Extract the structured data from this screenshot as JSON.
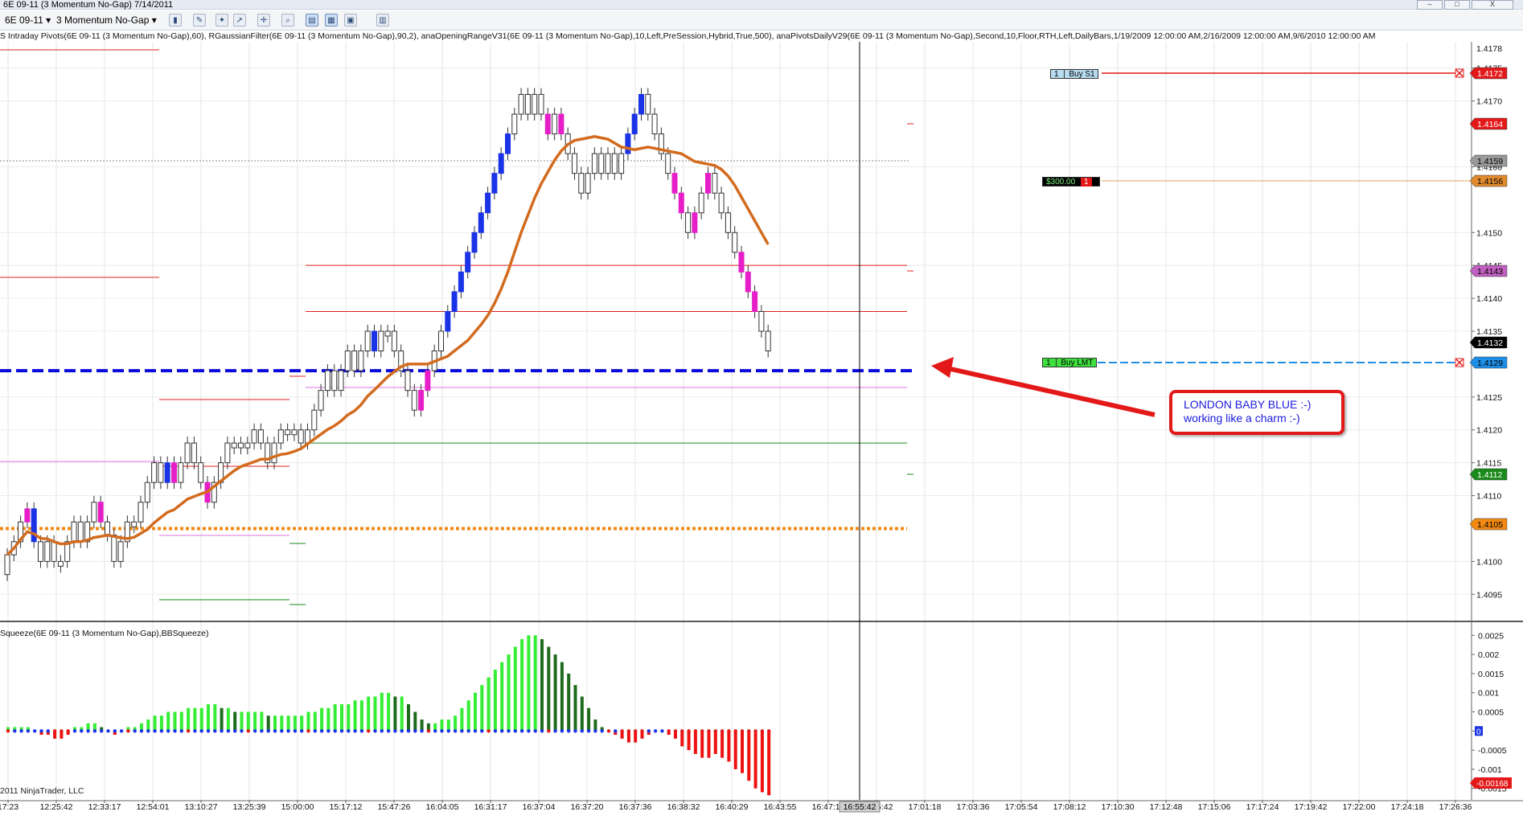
{
  "window": {
    "title": "6E 09-11 (3 Momentum No-Gap)  7/14/2011",
    "minimize": "–",
    "maximize": "□",
    "close": "X"
  },
  "toolbar": {
    "instrument": "6E 09-11",
    "period": "3 Momentum No-Gap"
  },
  "indicators_line": "S Intraday Pivots(6E 09-11 (3 Momentum No-Gap),60),  RGaussianFilter(6E 09-11 (3 Momentum No-Gap),90,2), anaOpeningRangeV31(6E 09-11 (3 Momentum No-Gap),10,Left,PreSession,Hybrid,True,500), anaPivotsDailyV29(6E 09-11 (3 Momentum No-Gap),Second,10,Floor,RTH,Left,DailyBars,1/19/2009 12:00:00 AM,2/16/2009 12:00:00 AM,9/6/2010 12:00:00 AM",
  "squeeze_label": "Squeeze(6E 09-11 (3 Momentum No-Gap),BBSqueeze)",
  "copyright": "2011 NinjaTrader, LLC",
  "callout": {
    "line1": "LONDON BABY BLUE :-)",
    "line2": "working like a charm :-)"
  },
  "orders": {
    "buy_s1": "Buy S1",
    "buy_s1_qty": "1",
    "buy_lmt": "Buy LMT",
    "buy_lmt_qty": "1",
    "position_pnl": "$300.00",
    "position_qty": "1"
  },
  "colors": {
    "up_candle": "#1a33e6",
    "down_candle": "#e61ec8",
    "gaussian": "#d36b1e",
    "london_line": "#0a0adc",
    "resistance": "#e02020",
    "support": "#1a8a1a",
    "opening_range": "#f28a12",
    "squeeze_up_strong": "#33ee33",
    "squeeze_up_weak": "#1e6b1e",
    "squeeze_down": "#ee1111"
  },
  "chart_data": {
    "type": "candlestick",
    "instrument": "6E 09-11",
    "price_axis_ticks": [
      1.4175,
      1.417,
      1.416,
      1.415,
      1.4145,
      1.414,
      1.4135,
      1.4125,
      1.412,
      1.4115,
      1.411,
      1.41,
      1.4095
    ],
    "price_axis_top_partial": [
      "1.4178",
      "1.4160"
    ],
    "price_markers": [
      {
        "label": "1.4172",
        "color": "#e31919",
        "text_color": "#ffffff"
      },
      {
        "label": "1.4164",
        "color": "#e31919",
        "text_color": "#ffffff"
      },
      {
        "label": "1.4159",
        "color": "#9a9a9a",
        "text_color": "#000000"
      },
      {
        "label": "1.4156",
        "color": "#e08a2e",
        "text_color": "#000000"
      },
      {
        "label": "1.4143",
        "color": "#c060c0",
        "text_color": "#000000"
      },
      {
        "label": "1.4132",
        "color": "#000000",
        "text_color": "#ffffff"
      },
      {
        "label": "1.4129",
        "color": "#1e8ee6",
        "text_color": "#000000"
      },
      {
        "label": "1.4112",
        "color": "#1a8a1a",
        "text_color": "#ffffff"
      },
      {
        "label": "1.4105",
        "color": "#f28a12",
        "text_color": "#000000"
      }
    ],
    "time_ticks": [
      "17:23",
      "12:25:42",
      "12:33:17",
      "12:54:01",
      "13:10:27",
      "13:25:39",
      "15:00:00",
      "15:17:12",
      "15:47:26",
      "16:04:05",
      "16:31:17",
      "16:37:04",
      "16:37:20",
      "16:37:36",
      "16:38:32",
      "16:40:29",
      "16:43:55",
      "16:47:14",
      "16:55:42",
      "17:01:18",
      "17:03:36",
      "17:05:54",
      "17:08:12",
      "17:10:30",
      "17:12:48",
      "17:15:06",
      "17:17:24",
      "17:19:42",
      "17:22:00",
      "17:24:18",
      "17:26:36"
    ],
    "crosshair_time": "16:55:42",
    "candles_close": [
      1.4101,
      1.4103,
      1.4106,
      1.4108,
      1.4103,
      1.41,
      1.4103,
      1.41,
      1.41,
      1.4103,
      1.4106,
      1.4103,
      1.4106,
      1.4109,
      1.4106,
      1.4104,
      1.41,
      1.4103,
      1.4106,
      1.4106,
      1.4109,
      1.4112,
      1.4115,
      1.4112,
      1.4115,
      1.4112,
      1.4115,
      1.4118,
      1.4115,
      1.4112,
      1.4109,
      1.4112,
      1.4115,
      1.4118,
      1.4118,
      1.4118,
      1.4118,
      1.412,
      1.4118,
      1.4115,
      1.4118,
      1.412,
      1.412,
      1.412,
      1.4118,
      1.412,
      1.4123,
      1.4126,
      1.4129,
      1.4126,
      1.4129,
      1.4132,
      1.4129,
      1.4132,
      1.4135,
      1.4132,
      1.4135,
      1.4135,
      1.4132,
      1.4129,
      1.4126,
      1.4123,
      1.4126,
      1.4129,
      1.4132,
      1.4135,
      1.4138,
      1.4141,
      1.4144,
      1.4147,
      1.415,
      1.4153,
      1.4156,
      1.4159,
      1.4162,
      1.4165,
      1.4168,
      1.4171,
      1.4168,
      1.4171,
      1.4168,
      1.4165,
      1.4168,
      1.4165,
      1.4162,
      1.4159,
      1.4156,
      1.4159,
      1.4162,
      1.4159,
      1.4162,
      1.4159,
      1.4162,
      1.4165,
      1.4168,
      1.4171,
      1.4168,
      1.4165,
      1.4162,
      1.4159,
      1.4156,
      1.4153,
      1.415,
      1.4153,
      1.4156,
      1.4159,
      1.4156,
      1.4153,
      1.415,
      1.4147,
      1.4144,
      1.4141,
      1.4138,
      1.4135,
      1.4132
    ],
    "levels": {
      "london_blue": 1.4129,
      "resistance_lines": [
        1.4145,
        1.4138,
        1.4164
      ],
      "support_line": 1.4118,
      "opening_range": 1.4105
    },
    "squeeze": {
      "ticks": [
        "0.0025",
        "0.002",
        "0.0015",
        "0.001",
        "0.0005",
        "0",
        "-0.0005",
        "-0.001",
        "-0.0015"
      ],
      "last_value_label": "-0.00168",
      "zero_label": "0",
      "values": [
        0.0001,
        0.0001,
        0.0001,
        0.0001,
        0.0,
        -0.0001,
        -0.0001,
        -0.0002,
        -0.0002,
        -0.0001,
        0.0001,
        0.0001,
        0.0002,
        0.0002,
        0.0001,
        0.0,
        -0.0001,
        0.0,
        0.0001,
        0.0001,
        0.0002,
        0.0003,
        0.0004,
        0.0004,
        0.0005,
        0.0005,
        0.0005,
        0.0006,
        0.0006,
        0.0006,
        0.0007,
        0.0007,
        0.0006,
        0.0006,
        0.0005,
        0.0005,
        0.0005,
        0.0005,
        0.0005,
        0.0004,
        0.0004,
        0.0004,
        0.0004,
        0.0004,
        0.0004,
        0.0005,
        0.0005,
        0.0006,
        0.0006,
        0.0007,
        0.0007,
        0.0007,
        0.0008,
        0.0008,
        0.0009,
        0.0009,
        0.001,
        0.001,
        0.0009,
        0.0009,
        0.0007,
        0.0005,
        0.0003,
        0.0002,
        0.0002,
        0.0003,
        0.0003,
        0.0004,
        0.0006,
        0.0008,
        0.001,
        0.0012,
        0.0014,
        0.0016,
        0.0018,
        0.002,
        0.0022,
        0.0024,
        0.0025,
        0.0025,
        0.0024,
        0.0022,
        0.002,
        0.0018,
        0.0015,
        0.0012,
        0.0009,
        0.0006,
        0.0003,
        0.0001,
        0.0,
        -0.0001,
        -0.0002,
        -0.0003,
        -0.0003,
        -0.0002,
        -0.0001,
        0.0,
        0.0,
        -0.0001,
        -0.0002,
        -0.0004,
        -0.0005,
        -0.0006,
        -0.0007,
        -0.0007,
        -0.0006,
        -0.0007,
        -0.0008,
        -0.001,
        -0.0011,
        -0.0013,
        -0.0015,
        -0.0016,
        -0.00168
      ]
    }
  }
}
